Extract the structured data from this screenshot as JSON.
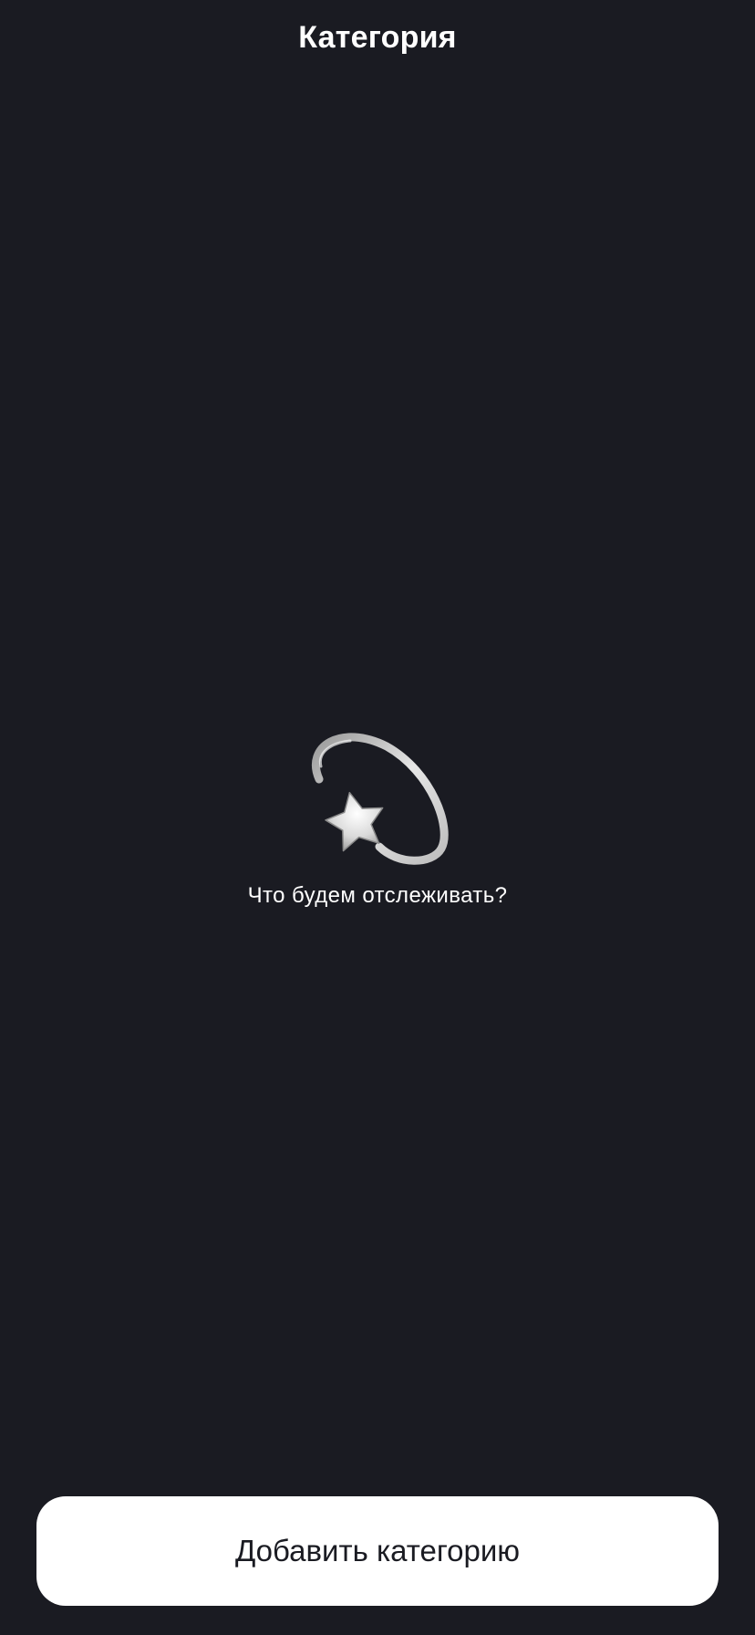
{
  "header": {
    "title": "Категория"
  },
  "empty_state": {
    "icon": "dizzy-star-icon",
    "message": "Что будем отслеживать?"
  },
  "footer": {
    "add_button_label": "Добавить категорию"
  },
  "colors": {
    "background": "#1A1B22",
    "text": "#FFFFFF",
    "button_bg": "#FFFFFF",
    "button_text": "#1A1B22"
  }
}
